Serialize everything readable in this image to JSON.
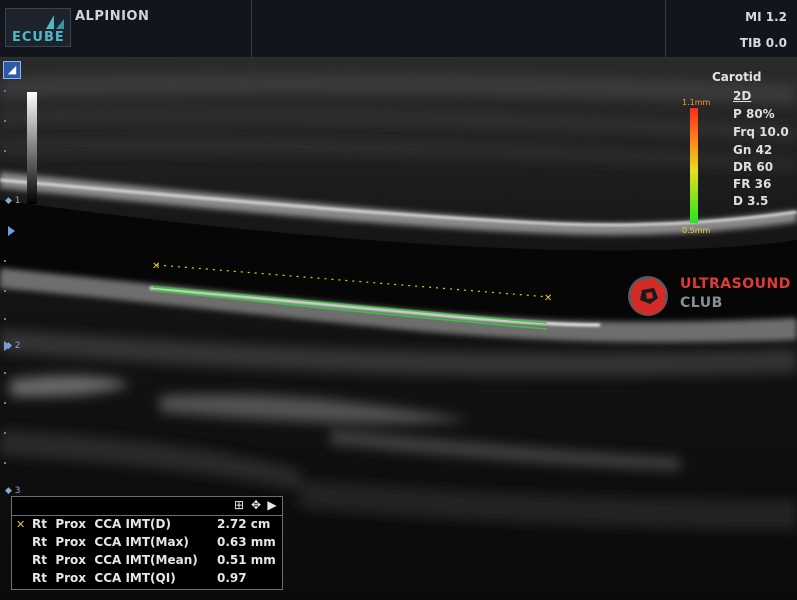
{
  "header": {
    "logo_text": "ECUBE",
    "brand": "ALPINION",
    "mi": "MI 1.2",
    "tib": "TIB 0.0"
  },
  "side_scale": {
    "depth_1": "1",
    "depth_2": "2",
    "depth_3": "3"
  },
  "imaging_params": {
    "preset": "Carotid",
    "mode": "2D",
    "power": "P 80%",
    "frequency": "Frq 10.0",
    "gain": "Gn 42",
    "dynamic_range": "DR 60",
    "frame_rate": "FR 36",
    "depth": "D 3.5"
  },
  "color_scale": {
    "max_label": "1.1mm",
    "min_label": "0.5mm",
    "colors": [
      "#ff2a1a",
      "#ff8a1a",
      "#e8e01a",
      "#7ee01a",
      "#22e622"
    ]
  },
  "watermark": {
    "title": "ULTRASOUND",
    "subtitle": "CLUB"
  },
  "results": {
    "toolbar_icons": [
      "grid-icon",
      "move-icon",
      "expand-arrow-icon"
    ],
    "rows": [
      {
        "label": "Rt  Prox  CCA IMT(D)",
        "value": "2.72 cm"
      },
      {
        "label": "Rt  Prox  CCA IMT(Max)",
        "value": "0.63 mm"
      },
      {
        "label": "Rt  Prox  CCA IMT(Mean)",
        "value": "0.51 mm"
      },
      {
        "label": "Rt  Prox  CCA IMT(QI)",
        "value": "0.97"
      }
    ],
    "accent_color": "#e6c52a"
  }
}
